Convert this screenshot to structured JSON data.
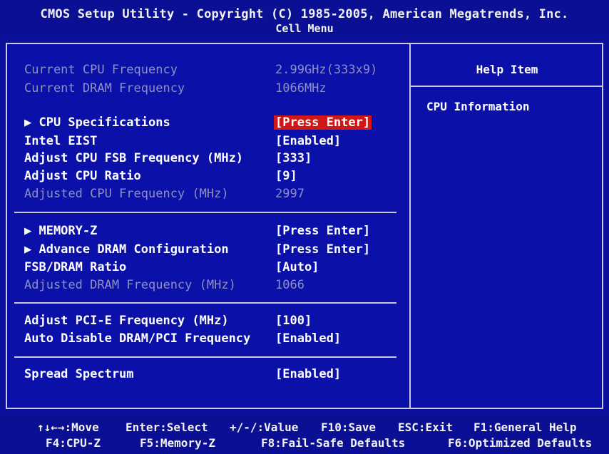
{
  "header": {
    "line1": "CMOS Setup Utility - Copyright (C) 1985-2005, American Megatrends, Inc.",
    "line2": "Cell Menu"
  },
  "rows": [
    {
      "label": "Current CPU Frequency",
      "value": "2.99GHz(333x9)"
    },
    {
      "label": "Current DRAM Frequency",
      "value": "1066MHz"
    },
    {
      "label": "▶ CPU Specifications",
      "value": "[Press Enter]"
    },
    {
      "label": "Intel EIST",
      "value": "[Enabled]"
    },
    {
      "label": "Adjust CPU FSB Frequency (MHz)",
      "value": "[333]"
    },
    {
      "label": "Adjust CPU Ratio",
      "value": "[9]"
    },
    {
      "label": "Adjusted CPU Frequency (MHz)",
      "value": "2997"
    },
    {
      "label": "▶ MEMORY-Z",
      "value": "[Press Enter]"
    },
    {
      "label": "▶ Advance DRAM Configuration",
      "value": "[Press Enter]"
    },
    {
      "label": "FSB/DRAM Ratio",
      "value": "[Auto]"
    },
    {
      "label": "Adjusted DRAM Frequency (MHz)",
      "value": "1066"
    },
    {
      "label": "Adjust PCI-E Frequency (MHz)",
      "value": "[100]"
    },
    {
      "label": "Auto Disable DRAM/PCI Frequency",
      "value": "[Enabled]"
    },
    {
      "label": "Spread Spectrum",
      "value": "[Enabled]"
    }
  ],
  "help": {
    "title": "Help Item",
    "text": "CPU Information"
  },
  "footer": {
    "move": "↑↓←→:Move",
    "select": "Enter:Select",
    "value": "+/-/:Value",
    "save": "F10:Save",
    "exit": "ESC:Exit",
    "general_help": "F1:General Help",
    "cpu_z": "F4:CPU-Z",
    "memory_z": "F5:Memory-Z",
    "failsafe": "F8:Fail-Safe Defaults",
    "optimized": "F6:Optimized Defaults"
  },
  "colors": {
    "background": "#0b0f9a",
    "highlight": "#d01818",
    "disabled_text": "#8c90c4",
    "border": "#c8c8e0"
  }
}
